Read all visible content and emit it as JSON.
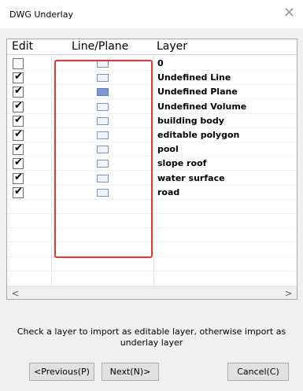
{
  "window": {
    "title": "DWG Underlay",
    "close_glyph": "✕"
  },
  "table": {
    "headers": {
      "edit": "Edit",
      "line_plane": "Line/Plane",
      "layer": "Layer"
    },
    "rows": [
      {
        "checked": false,
        "swatch": "outline",
        "name": "0"
      },
      {
        "checked": true,
        "swatch": "outline",
        "name": "Undefined Line"
      },
      {
        "checked": true,
        "swatch": "filled",
        "name": "Undefined Plane"
      },
      {
        "checked": true,
        "swatch": "outline",
        "name": "Undefined Volume"
      },
      {
        "checked": true,
        "swatch": "outline",
        "name": "building body"
      },
      {
        "checked": true,
        "swatch": "outline",
        "name": "editable polygon"
      },
      {
        "checked": true,
        "swatch": "outline",
        "name": "pool"
      },
      {
        "checked": true,
        "swatch": "outline",
        "name": "slope roof"
      },
      {
        "checked": true,
        "swatch": "outline",
        "name": "water surface"
      },
      {
        "checked": true,
        "swatch": "outline",
        "name": "road"
      }
    ],
    "check_glyph": "✔",
    "scroll_left_glyph": "<",
    "scroll_right_glyph": ">"
  },
  "hint": "Check a layer to import as editable layer, otherwise import as underlay layer",
  "buttons": {
    "previous": "<Previous(P)",
    "next": "Next(N)>",
    "cancel": "Cancel(C)"
  },
  "colors": {
    "highlight_box": "#e8352b",
    "swatch_filled": "#7c97d2",
    "swatch_outline": "#7d94c7"
  }
}
